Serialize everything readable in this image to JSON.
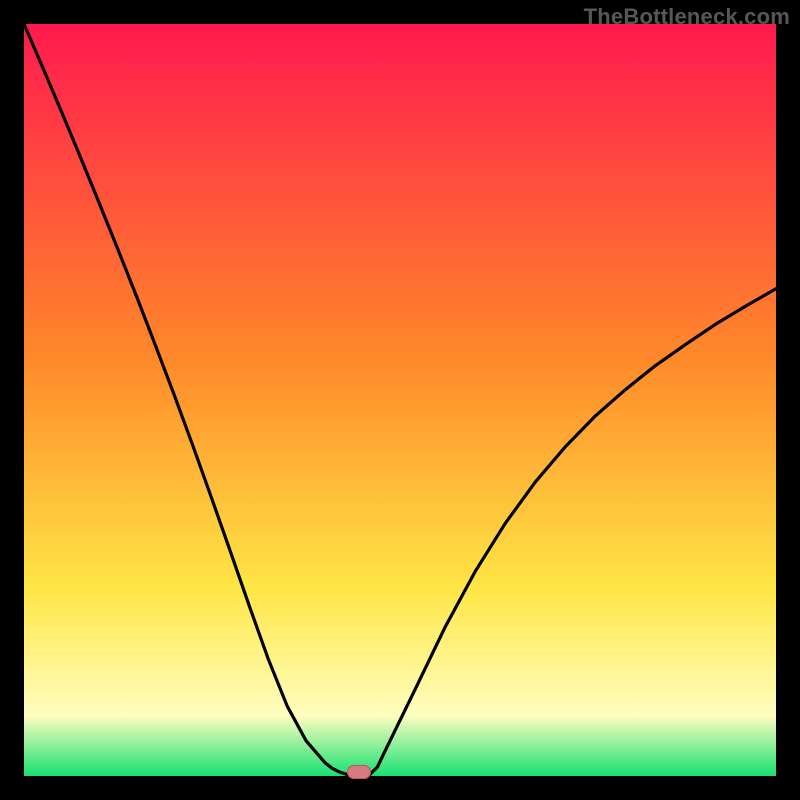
{
  "watermark": {
    "text": "TheBottleneck.com"
  },
  "colors": {
    "frame_bg": "#000000",
    "grad_top": "#ff1a4e",
    "grad_mid1": "#ff8a2a",
    "grad_mid2": "#ffe646",
    "grad_low": "#fffec0",
    "grad_bottom": "#18e072",
    "curve": "#000000",
    "marker_fill": "#d97a82",
    "marker_stroke": "#b85b63"
  },
  "chart_data": {
    "type": "line",
    "title": "",
    "xlabel": "",
    "ylabel": "",
    "xlim": [
      0,
      1
    ],
    "ylim": [
      0,
      1
    ],
    "x": [
      0.0,
      0.025,
      0.05,
      0.075,
      0.1,
      0.125,
      0.15,
      0.175,
      0.2,
      0.225,
      0.25,
      0.275,
      0.3,
      0.325,
      0.35,
      0.375,
      0.4,
      0.41,
      0.42,
      0.43,
      0.44,
      0.45,
      0.46,
      0.47,
      0.48,
      0.52,
      0.56,
      0.6,
      0.64,
      0.68,
      0.72,
      0.76,
      0.8,
      0.84,
      0.88,
      0.92,
      0.96,
      1.0
    ],
    "values": [
      1.0,
      0.942,
      0.883,
      0.823,
      0.762,
      0.7,
      0.637,
      0.572,
      0.506,
      0.438,
      0.368,
      0.297,
      0.225,
      0.155,
      0.093,
      0.047,
      0.018,
      0.01,
      0.005,
      0.002,
      0.0,
      0.0,
      0.002,
      0.012,
      0.033,
      0.115,
      0.198,
      0.272,
      0.336,
      0.391,
      0.438,
      0.479,
      0.514,
      0.546,
      0.574,
      0.601,
      0.625,
      0.648
    ],
    "min_x": 0.445,
    "marker": {
      "x": 0.445,
      "y": 0.0
    },
    "grid": false,
    "legend": null,
    "annotations": []
  }
}
